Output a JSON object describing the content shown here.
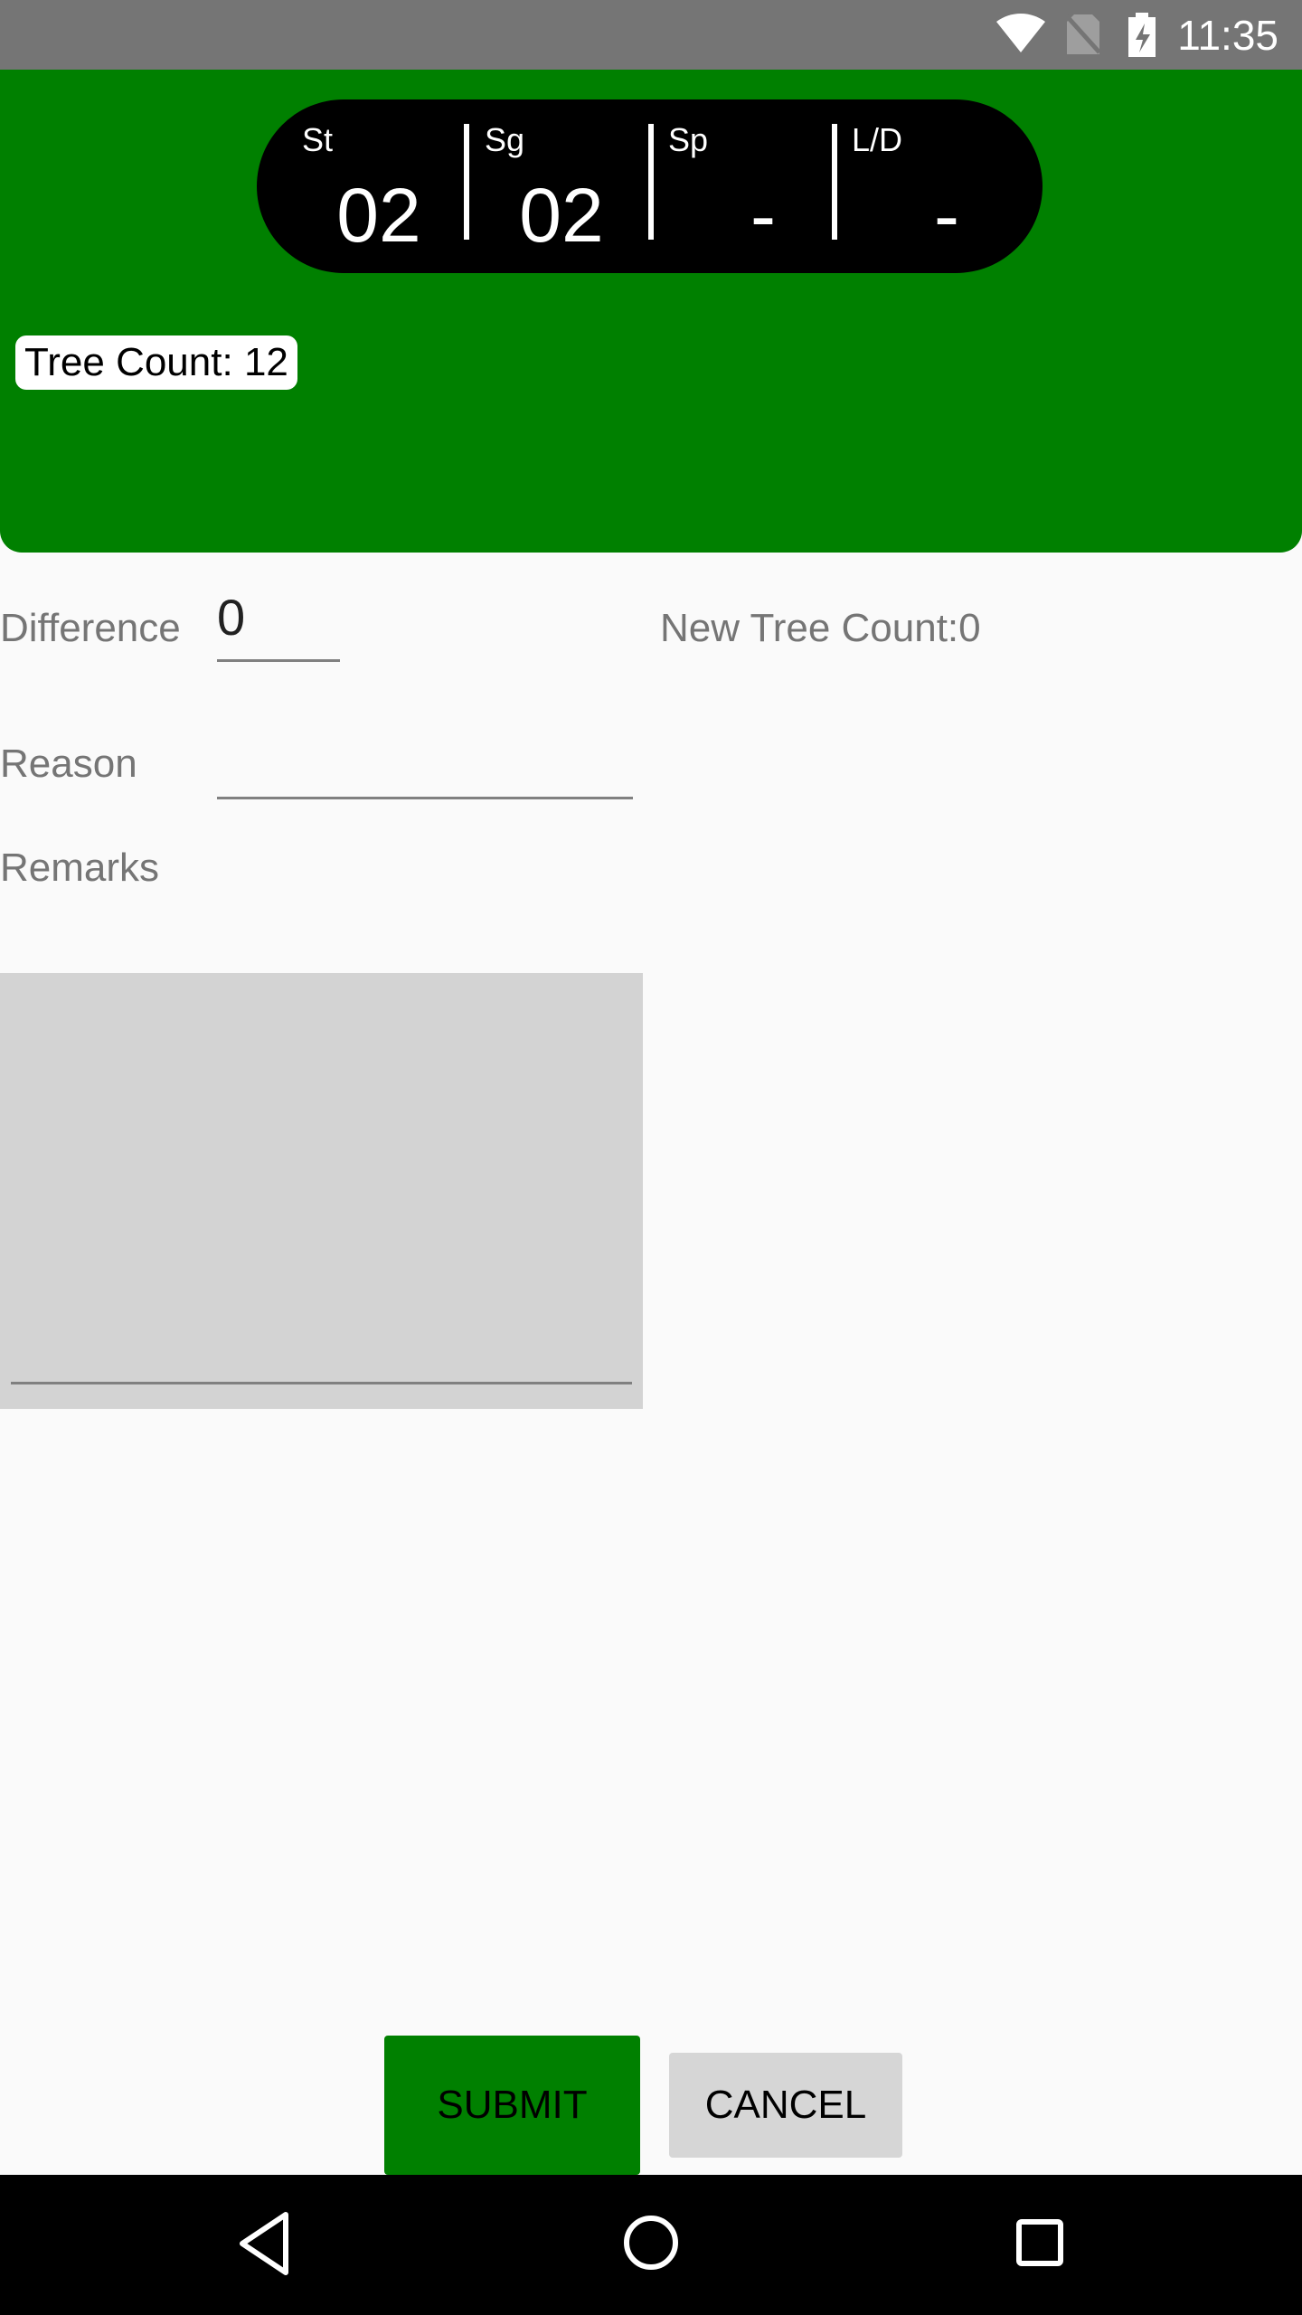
{
  "status_bar": {
    "time": "11:35",
    "icons": [
      "wifi-icon",
      "no-sim-icon",
      "battery-icon"
    ]
  },
  "header": {
    "segments": [
      {
        "label": "St",
        "value": "02"
      },
      {
        "label": "Sg",
        "value": "02"
      },
      {
        "label": "Sp",
        "value": "-"
      },
      {
        "label": "L/D",
        "value": "-"
      }
    ],
    "tree_count_label": "Tree Count:",
    "tree_count_value": "12"
  },
  "form": {
    "difference_label": "Difference",
    "difference_value": "0",
    "new_tree_count_text": "New Tree Count:0",
    "reason_label": "Reason",
    "reason_value": "",
    "remarks_label": "Remarks",
    "remarks_value": ""
  },
  "actions": {
    "submit_label": "SUBMIT",
    "cancel_label": "CANCEL"
  },
  "nav_bar": {
    "icons": [
      "back-icon",
      "home-icon",
      "recents-icon"
    ]
  },
  "colors": {
    "header_green": "#008000",
    "pill_black": "#000000",
    "status_bar_gray": "#757575",
    "remarks_bg": "#d3d3d3",
    "cancel_bg": "#d6d6d6"
  }
}
